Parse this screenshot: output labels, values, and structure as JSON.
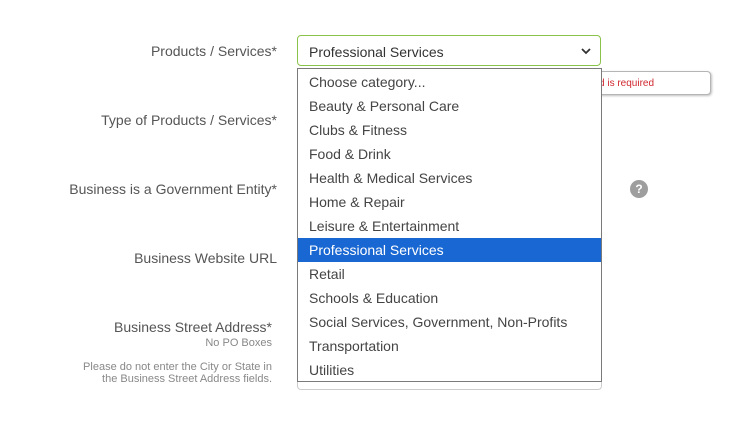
{
  "form": {
    "products_label": "Products / Services*",
    "type_label": "Type of Products / Services*",
    "gov_label": "Business is a Government Entity*",
    "website_label": "Business Website URL",
    "address_label": "Business Street Address*",
    "address_sub": "No PO Boxes",
    "address_note_1": "Please do not enter the City or State in",
    "address_note_2": "the Business Street Address fields."
  },
  "select": {
    "value": "Professional Services",
    "options": [
      "Choose category...",
      "Beauty & Personal Care",
      "Clubs & Fitness",
      "Food & Drink",
      "Health & Medical Services",
      "Home & Repair",
      "Leisure & Entertainment",
      "Professional Services",
      "Retail",
      "Schools & Education",
      "Social Services, Government, Non-Profits",
      "Transportation",
      "Utilities"
    ],
    "highlighted_index": 7
  },
  "error": {
    "text": "ield is required"
  },
  "help": {
    "glyph": "?",
    "icon": "help-icon"
  },
  "colors": {
    "accent_border": "#8bc34a",
    "highlight": "#1967d2",
    "error_text": "#d0272f"
  }
}
